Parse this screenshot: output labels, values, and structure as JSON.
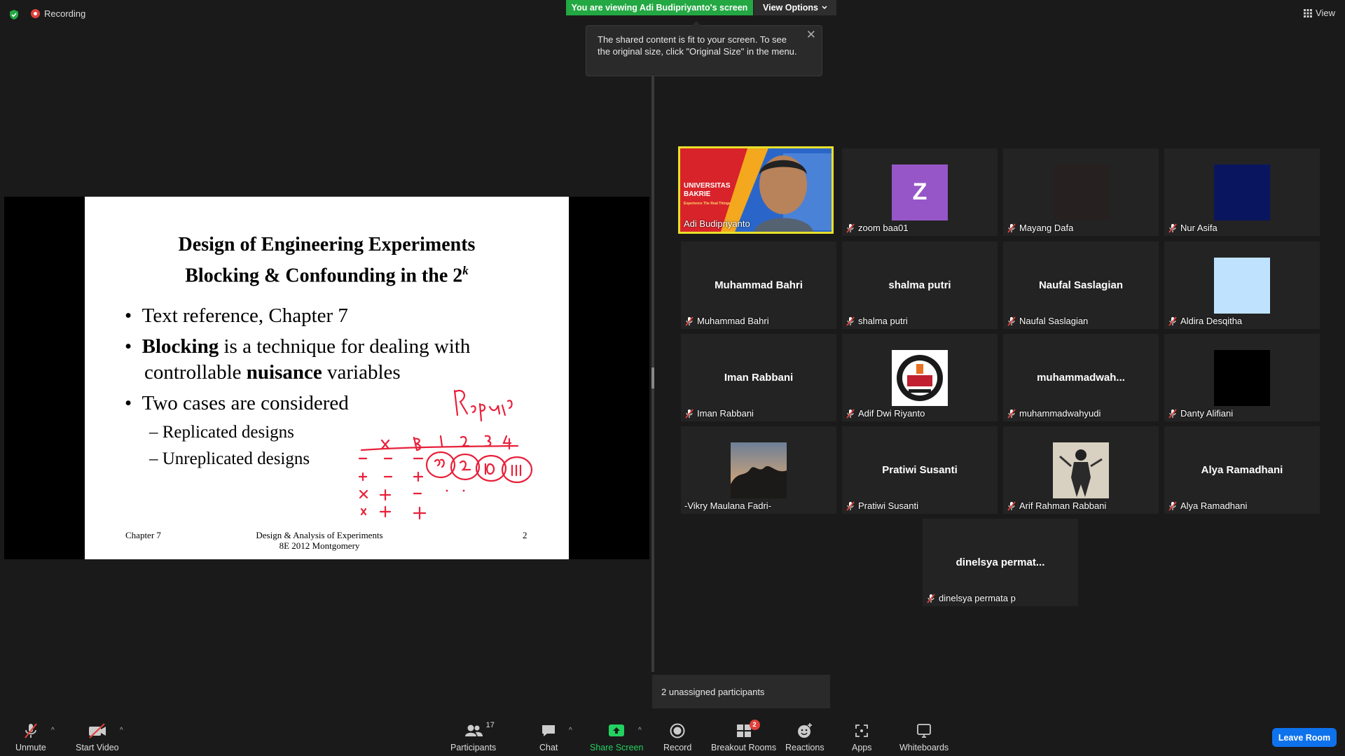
{
  "top": {
    "recording_label": "Recording",
    "viewing_banner": "You are viewing Adi Budipriyanto's screen",
    "view_options": "View Options",
    "view_label": "View",
    "tooltip_text": "The shared content is fit to your screen. To see the original size, click \"Original Size\" in the menu."
  },
  "slide": {
    "title_line1": "Design of Engineering Experiments",
    "title_line2": "Blocking & Confounding in the 2",
    "title_sup": "k",
    "bullet1": "Text reference, Chapter 7",
    "bullet2_bold": "Blocking",
    "bullet2_rest": " is a technique for dealing with",
    "bullet2_line2_pre": "controllable ",
    "bullet2_line2_bold": "nuisance",
    "bullet2_line2_post": " variables",
    "bullet3": "Two cases are considered",
    "sub1": "Replicated designs",
    "sub2": "Unreplicated designs",
    "footer_left": "Chapter 7",
    "footer_center_1": "Design & Analysis of Experiments",
    "footer_center_2": "8E 2012 Montgomery",
    "footer_right": "2"
  },
  "participants": [
    {
      "display": "",
      "label": "Adi Budipriyanto",
      "type": "video"
    },
    {
      "display": "Z",
      "label": "zoom baa01",
      "type": "avatar",
      "color": "#9656c8"
    },
    {
      "display": "",
      "label": "Mayang Dafa",
      "type": "dark"
    },
    {
      "display": "",
      "label": "Nur Asifa",
      "type": "navy"
    },
    {
      "display": "Muhammad Bahri",
      "label": "Muhammad Bahri",
      "type": "name"
    },
    {
      "display": "shalma putri",
      "label": "shalma putri",
      "type": "name"
    },
    {
      "display": "Naufal Saslagian",
      "label": "Naufal Saslagian",
      "type": "name"
    },
    {
      "display": "",
      "label": "Aldira Desqitha",
      "type": "lightblue"
    },
    {
      "display": "Iman Rabbani",
      "label": "Iman Rabbani",
      "type": "name"
    },
    {
      "display": "",
      "label": "Adif Dwi Riyanto",
      "type": "logo"
    },
    {
      "display": "muhammadwah...",
      "label": "muhammadwahyudi",
      "type": "name"
    },
    {
      "display": "",
      "label": "Danty Alifiani",
      "type": "black"
    },
    {
      "display": "",
      "label": "-Vikry Maulana Fadri-",
      "type": "sky"
    },
    {
      "display": "Pratiwi Susanti",
      "label": "Pratiwi Susanti",
      "type": "name"
    },
    {
      "display": "",
      "label": "Arif Rahman Rabbani",
      "type": "figure"
    },
    {
      "display": "Alya Ramadhani",
      "label": "Alya Ramadhani",
      "type": "name"
    },
    {
      "display": "dinelsya  permat...",
      "label": "dinelsya permata p",
      "type": "name"
    }
  ],
  "presenter_tile": {
    "univ_line1": "UNIVERSITAS",
    "univ_line2": "BAKRIE",
    "tagline": "Experience The Real Things"
  },
  "unassigned": "2 unassigned participants",
  "toolbar": {
    "unmute": "Unmute",
    "start_video": "Start Video",
    "participants": "Participants",
    "participants_count": "17",
    "chat": "Chat",
    "share_screen": "Share Screen",
    "record": "Record",
    "breakout_rooms": "Breakout Rooms",
    "breakout_badge": "2",
    "reactions": "Reactions",
    "apps": "Apps",
    "whiteboards": "Whiteboards",
    "leave_room": "Leave Room"
  },
  "colors": {
    "banner_green": "#23a843",
    "share_green": "#23d160",
    "leave_blue": "#0e72ed",
    "active_border": "#e8e02a",
    "annotation_red": "#e8203a"
  }
}
